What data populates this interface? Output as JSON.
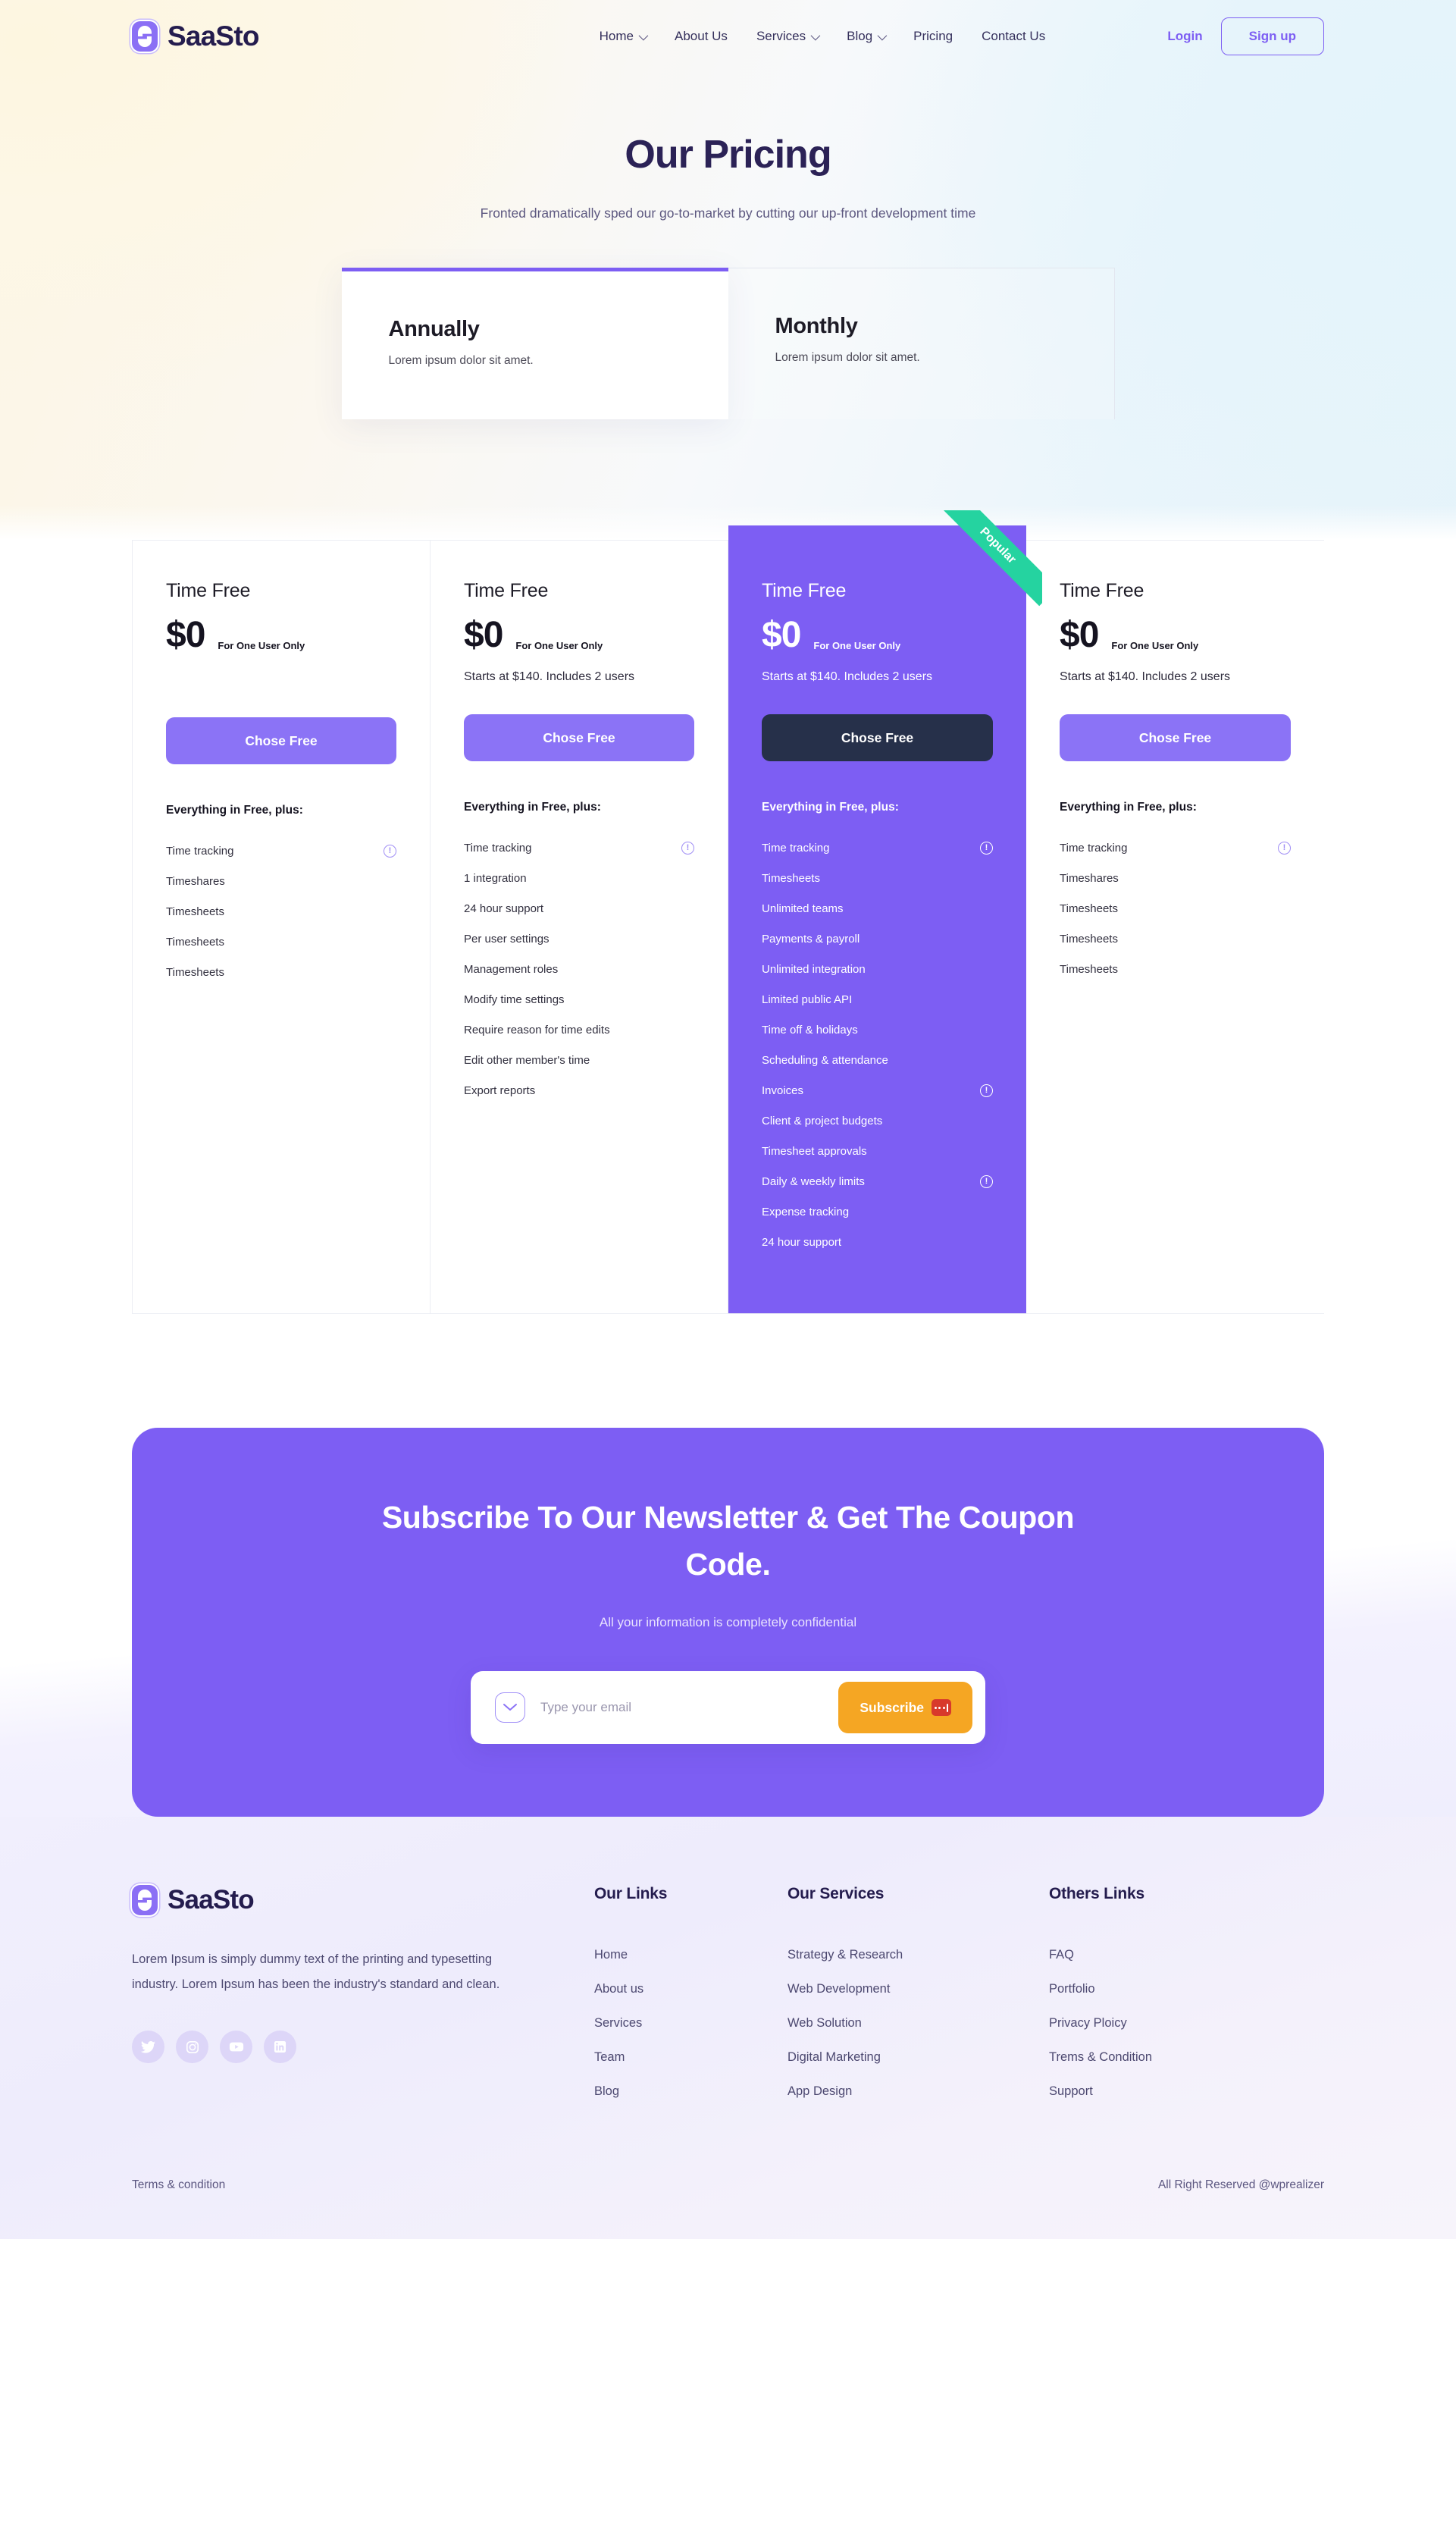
{
  "colors": {
    "accent": "#7d5ef3",
    "accent_light": "#8b73f6",
    "dark": "#26304a",
    "ribbon_green": "#25d3a0",
    "subscribe_orange": "#f5a623",
    "heading": "#2b2256"
  },
  "nav": {
    "brand": "SaaSto",
    "links": [
      {
        "label": "Home",
        "has_caret": true
      },
      {
        "label": "About Us",
        "has_caret": false
      },
      {
        "label": "Services",
        "has_caret": true
      },
      {
        "label": "Blog",
        "has_caret": true
      },
      {
        "label": "Pricing",
        "has_caret": false
      },
      {
        "label": "Contact Us",
        "has_caret": false
      }
    ],
    "login": "Login",
    "signup": "Sign up"
  },
  "hero": {
    "title": "Our Pricing",
    "subtitle": "Fronted dramatically sped our go-to-market by cutting our up-front development time"
  },
  "tabs": [
    {
      "title": "Annually",
      "desc": "Lorem ipsum dolor sit amet.",
      "active": true
    },
    {
      "title": "Monthly",
      "desc": "Lorem ipsum dolor sit amet.",
      "active": false
    }
  ],
  "plans": [
    {
      "name": "Time Free",
      "price": "$0",
      "price_note": "For One User Only",
      "starts_at": "",
      "cta": "Chose Free",
      "plus_head": "Everything in Free, plus:",
      "featured": false,
      "badge": "",
      "features": [
        {
          "label": "Time tracking",
          "info": true
        },
        {
          "label": "Timeshares",
          "info": false
        },
        {
          "label": "Timesheets",
          "info": false
        },
        {
          "label": "Timesheets",
          "info": false
        },
        {
          "label": "Timesheets",
          "info": false
        }
      ]
    },
    {
      "name": "Time Free",
      "price": "$0",
      "price_note": "For One User Only",
      "starts_at": "Starts at $140. Includes 2 users",
      "cta": "Chose Free",
      "plus_head": "Everything in Free, plus:",
      "featured": false,
      "badge": "",
      "features": [
        {
          "label": "Time tracking",
          "info": true
        },
        {
          "label": "1 integration",
          "info": false
        },
        {
          "label": "24 hour support",
          "info": false
        },
        {
          "label": "Per user settings",
          "info": false
        },
        {
          "label": "Management roles",
          "info": false
        },
        {
          "label": "Modify time settings",
          "info": false
        },
        {
          "label": "Require reason for time edits",
          "info": false
        },
        {
          "label": "Edit other member's time",
          "info": false
        },
        {
          "label": "Export reports",
          "info": false
        }
      ]
    },
    {
      "name": "Time Free",
      "price": "$0",
      "price_note": "For One User Only",
      "starts_at": "Starts at $140. Includes 2 users",
      "cta": "Chose Free",
      "plus_head": "Everything in Free, plus:",
      "featured": true,
      "badge": "Popular",
      "features": [
        {
          "label": "Time tracking",
          "info": true
        },
        {
          "label": "Timesheets",
          "info": false
        },
        {
          "label": "Unlimited teams",
          "info": false
        },
        {
          "label": "Payments & payroll",
          "info": false
        },
        {
          "label": "Unlimited integration",
          "info": false
        },
        {
          "label": "Limited public API",
          "info": false
        },
        {
          "label": "Time off & holidays",
          "info": false
        },
        {
          "label": "Scheduling & attendance",
          "info": false
        },
        {
          "label": "Invoices",
          "info": true
        },
        {
          "label": "Client & project budgets",
          "info": false
        },
        {
          "label": "Timesheet approvals",
          "info": false
        },
        {
          "label": "Daily & weekly limits",
          "info": true
        },
        {
          "label": "Expense tracking",
          "info": false
        },
        {
          "label": "24 hour support",
          "info": false
        }
      ]
    },
    {
      "name": "Time Free",
      "price": "$0",
      "price_note": "For One User Only",
      "starts_at": "Starts at $140. Includes 2 users",
      "cta": "Chose Free",
      "plus_head": "Everything in Free, plus:",
      "featured": false,
      "badge": "",
      "features": [
        {
          "label": "Time tracking",
          "info": true
        },
        {
          "label": "Timeshares",
          "info": false
        },
        {
          "label": "Timesheets",
          "info": false
        },
        {
          "label": "Timesheets",
          "info": false
        },
        {
          "label": "Timesheets",
          "info": false
        }
      ]
    }
  ],
  "newsletter": {
    "title": "Subscribe To Our Newsletter & Get The Coupon Code.",
    "subtitle": "All your information is completely confidential",
    "input_placeholder": "Type your email",
    "input_value": "",
    "button": "Subscribe"
  },
  "footer": {
    "brand": "SaaSto",
    "about": "Lorem Ipsum is simply dummy text of the printing and typesetting industry. Lorem Ipsum has been the industry's standard and clean.",
    "socials": [
      {
        "name": "twitter-icon"
      },
      {
        "name": "instagram-icon"
      },
      {
        "name": "youtube-icon"
      },
      {
        "name": "linkedin-icon"
      }
    ],
    "columns": [
      {
        "title": "Our Links",
        "links": [
          "Home",
          "About us",
          "Services",
          "Team",
          "Blog"
        ]
      },
      {
        "title": "Our Services",
        "links": [
          "Strategy & Research",
          "Web Development",
          "Web Solution",
          "Digital Marketing",
          "App Design"
        ]
      },
      {
        "title": "Others Links",
        "links": [
          "FAQ",
          "Portfolio",
          "Privacy Ploicy",
          "Trems & Condition",
          "Support"
        ]
      }
    ],
    "bottom_left": "Terms & condition",
    "bottom_right": "All Right Reserved @wprealizer"
  }
}
